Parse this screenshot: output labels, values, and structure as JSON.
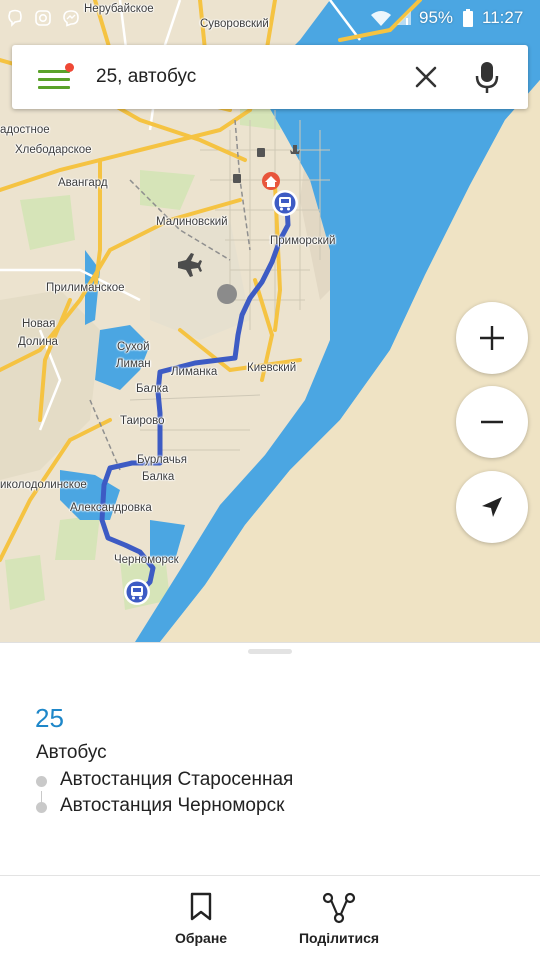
{
  "status_bar": {
    "battery_text": "95%",
    "time": "11:27",
    "icons": [
      "viber-icon",
      "instagram-icon",
      "messenger-icon",
      "wifi-icon",
      "signal-icon",
      "battery-icon"
    ]
  },
  "search": {
    "value": "25, автобус",
    "menu_icon": "hamburger-menu-icon",
    "clear_icon": "close-icon",
    "mic_icon": "microphone-icon"
  },
  "map": {
    "labels": [
      "Нерубайское",
      "Суворовский",
      "адостное",
      "Хлебодарское",
      "Авангард",
      "Малиновский",
      "Приморский",
      "Прилиманское",
      "Новая",
      "Долина",
      "Сухой",
      "Лиман",
      "Лиманка",
      "Киевский",
      "Балка",
      "Таирово",
      "Бурлачья",
      "Балка",
      "иколодолинское",
      "Александровка",
      "Черноморск"
    ],
    "controls": {
      "zoom_in_icon": "plus-icon",
      "zoom_out_icon": "minus-icon",
      "locate_icon": "navigation-arrow-icon"
    },
    "colors": {
      "water": "#4ba6e2",
      "route": "#3d5bc4",
      "major_road": "#f5c342",
      "land": "#ece3cf"
    }
  },
  "route": {
    "number": "25",
    "type": "Автобус",
    "stops": [
      "Автостанция Старосенная",
      "Автостанция Черноморск"
    ]
  },
  "toolbar": {
    "saved_label": "Обране",
    "saved_icon": "bookmark-icon",
    "share_label": "Поділитися",
    "share_icon": "share-icon"
  }
}
